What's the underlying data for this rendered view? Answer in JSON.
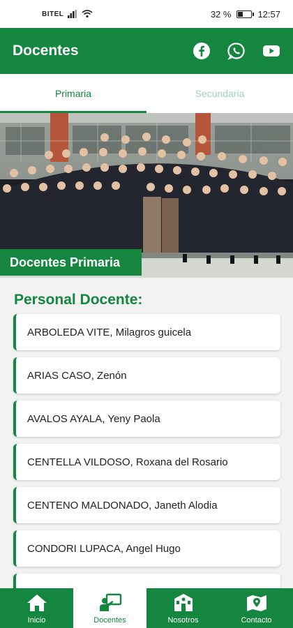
{
  "status": {
    "carrier": "BITEL",
    "battery": "32 %",
    "battery_level": 0.32,
    "time": "12:57"
  },
  "header": {
    "title": "Docentes"
  },
  "social": [
    {
      "name": "facebook-icon"
    },
    {
      "name": "whatsapp-icon"
    },
    {
      "name": "youtube-icon"
    }
  ],
  "tabs": [
    {
      "label": "Primaria",
      "selected": true
    },
    {
      "label": "Secundaria",
      "selected": false
    }
  ],
  "hero": {
    "label": "Docentes Primaria"
  },
  "section": {
    "title": "Personal Docente:"
  },
  "teachers": [
    "ARBOLEDA VITE, Milagros guicela",
    "ARIAS CASO, Zenón",
    "AVALOS AYALA, Yeny Paola",
    "CENTELLA VILDOSO, Roxana del Rosario",
    "CENTENO MALDONADO, Janeth Alodia",
    "CONDORI LUPACA, Angel Hugo",
    ""
  ],
  "nav": {
    "inicio": "Inicio",
    "docentes": "Docentes",
    "nosotros": "Nosotros",
    "contacto": "Contacto"
  },
  "colors": {
    "primary": "#15863f",
    "inactive_tab": "#9fd3b0"
  }
}
